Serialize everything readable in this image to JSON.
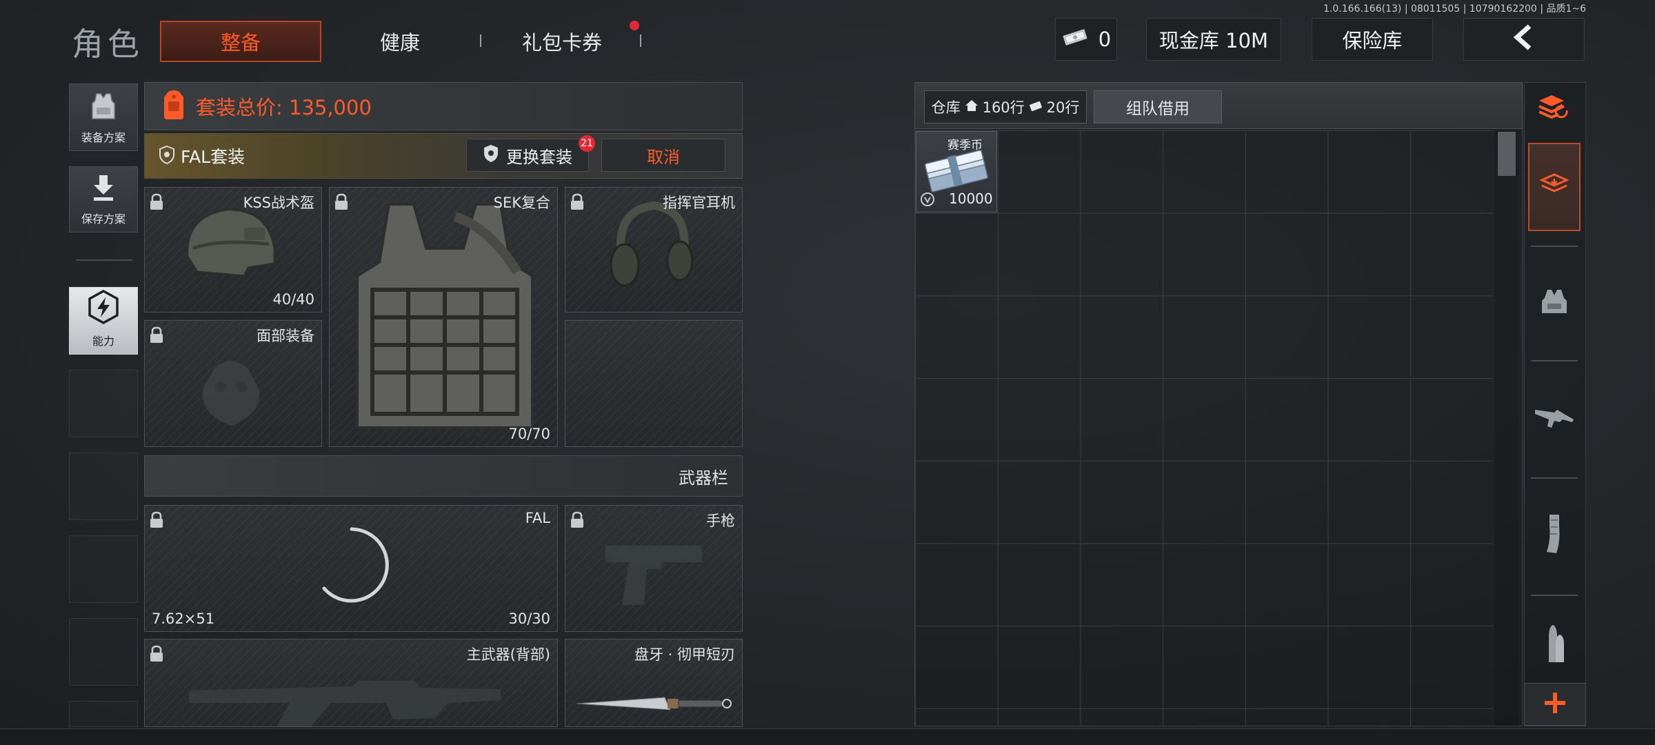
{
  "build_info": "1.0.166.166(13) | 08011505 | 10790162200 | 品质1~6",
  "header": {
    "title": "角色",
    "tabs": [
      {
        "label": "整备",
        "active": true
      },
      {
        "label": "健康",
        "active": false
      },
      {
        "label": "礼包卡券",
        "active": false,
        "has_notification": true
      }
    ],
    "money_amount": "0",
    "cash_vault": "现金库 10M",
    "safe_box": "保险库"
  },
  "sidebar": {
    "items": [
      {
        "label": "装备方案",
        "icon": "vest-icon"
      },
      {
        "label": "保存方案",
        "icon": "download-icon"
      },
      {
        "label": "能力",
        "icon": "lightning-icon",
        "active": true
      }
    ]
  },
  "loadout": {
    "total_price": "套装总价: 135,000",
    "set_name": "FAL套装",
    "change_set_label": "更换套装",
    "change_set_badge": "21",
    "cancel_label": "取消",
    "slots": {
      "helmet": {
        "name": "KSS战术盔",
        "durability": "40/40"
      },
      "face": {
        "name": "面部装备"
      },
      "armor": {
        "name": "SEK复合",
        "durability": "70/70"
      },
      "headset": {
        "name": "指挥官耳机"
      }
    },
    "weapon_header": "武器栏",
    "weapons": {
      "primary": {
        "name": "FAL",
        "caliber": "7.62×51",
        "ammo": "30/30"
      },
      "pistol": {
        "name": "手枪"
      },
      "back": {
        "name": "主武器(背部)"
      },
      "melee": {
        "name": "盘牙 · 彻甲短刃"
      }
    }
  },
  "storage": {
    "warehouse_label": "仓库",
    "warehouse_rows": "160行",
    "extra_rows": "20行",
    "team_tab": "组队借用",
    "items": [
      {
        "name": "赛季币",
        "quantity": "10000",
        "icon": "cash-stack-icon"
      }
    ]
  },
  "categories": [
    "layers-refresh-icon",
    "inventory-icon",
    "armor-icon",
    "rifle-icon",
    "magazine-icon",
    "ammo-icon"
  ],
  "colors": {
    "accent": "#ff5a2a",
    "notification": "#e12a36",
    "panel": "#2e3134"
  }
}
